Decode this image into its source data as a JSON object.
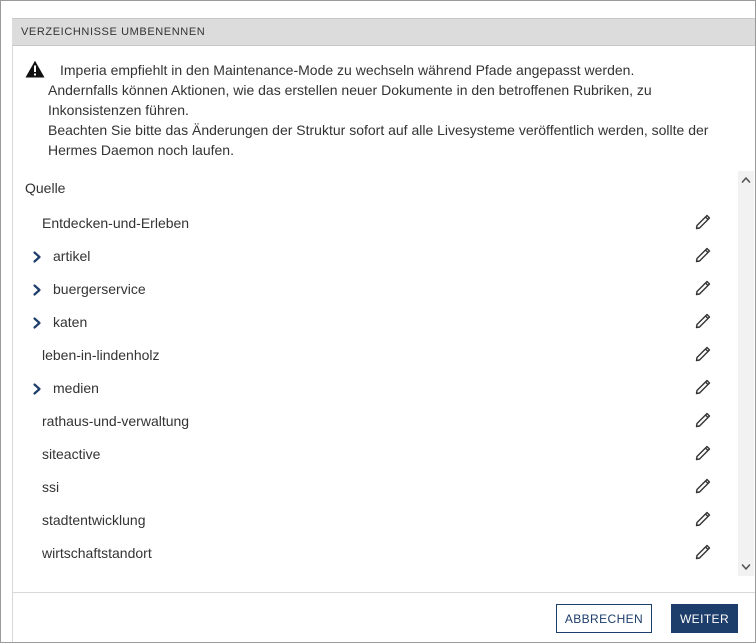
{
  "dialog": {
    "title": "VERZEICHNISSE UMBENENNEN"
  },
  "warning": {
    "icon": "warning-triangle-icon",
    "line1": "Imperia empfiehlt in den Maintenance-Mode zu wechseln während Pfade angepasst werden.",
    "line2": "Andernfalls können Aktionen, wie das erstellen neuer Dokumente in den betroffenen Rubriken, zu Inkonsistenzen führen.",
    "line3": "Beachten Sie bitte das Änderungen der Struktur sofort auf alle Livesysteme veröffentlich werden, sollte der Hermes Daemon noch laufen."
  },
  "tree": {
    "header": "Quelle",
    "items": [
      {
        "label": "Entdecken-und-Erleben",
        "expandable": false
      },
      {
        "label": "artikel",
        "expandable": true
      },
      {
        "label": "buergerservice",
        "expandable": true
      },
      {
        "label": "katen",
        "expandable": true
      },
      {
        "label": "leben-in-lindenholz",
        "expandable": false
      },
      {
        "label": "medien",
        "expandable": true
      },
      {
        "label": "rathaus-und-verwaltung",
        "expandable": false
      },
      {
        "label": "siteactive",
        "expandable": false
      },
      {
        "label": "ssi",
        "expandable": false
      },
      {
        "label": "stadtentwicklung",
        "expandable": false
      },
      {
        "label": "wirtschaftstandort",
        "expandable": false
      }
    ]
  },
  "footer": {
    "cancel_label": "ABBRECHEN",
    "next_label": "WEITER"
  },
  "colors": {
    "primary": "#1d3d6b",
    "title_bar": "#dcdcdc",
    "text": "#333333"
  }
}
